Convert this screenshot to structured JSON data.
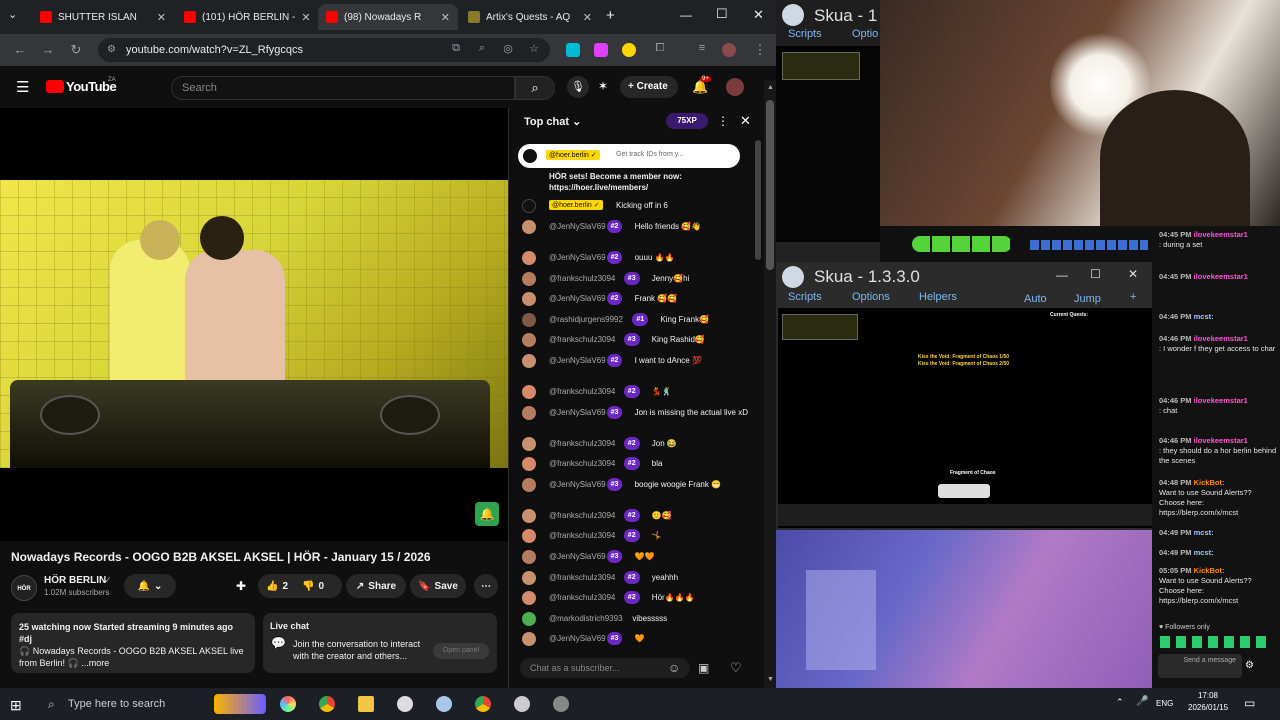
{
  "browser": {
    "tabs": [
      {
        "label": "SHUTTER ISLAN",
        "color": "#ff0000"
      },
      {
        "label": "(101) HÖR BERLIN -",
        "color": "#ff0000"
      },
      {
        "label": "(98) Nowadays R",
        "color": "#ff0000"
      },
      {
        "label": "Artix's Quests - AQ",
        "color": "#8b7a2a"
      }
    ],
    "url": "youtube.com/watch?v=ZL_Rfygcqcs"
  },
  "youtube": {
    "logo": "YouTube",
    "logo_region": "ZA",
    "search_placeholder": "Search",
    "create_label": "Create",
    "notif_count": "9+",
    "video_title": "Nowadays Records - OOGO B2B AKSEL AKSEL | HÖR - January 15 / 2026",
    "channel_name": "HÖR BERLIN",
    "subscribers": "1.02M subscribers",
    "like_count": "2",
    "dislike_count": "0",
    "share_label": "Share",
    "save_label": "Save",
    "desc_line1": "25 watching now  Started streaming 9 minutes ago  #dj",
    "desc_line2": "🎧 Nowadays Records - OOGO B2B AKSEL AKSEL live",
    "desc_line3": "from Berlin! 🎧 ...more",
    "livechat_title": "Live chat",
    "livechat_text": "Join the conversation to interact with the creator and others...",
    "open_panel": "Open panel"
  },
  "chat": {
    "header": "Top chat",
    "xp": "75XP",
    "pinned_name": "@hoer.berlin ✓",
    "pinned_text": "Get track IDs from y...",
    "pinned_msg": "HÖR sets! Become a member now: https://hoer.live/members/",
    "msg0_name": "@hoer.berlin ✓",
    "msg0_text": "Kicking off in 6",
    "messages": [
      {
        "name": "@JenNySlaV69",
        "badge": "#2",
        "text": "Hello friends 🥰👋"
      },
      {
        "name": "@JenNySlaV69",
        "badge": "#2",
        "text": "ouuu 🔥🔥"
      },
      {
        "name": "@frankschulz3094",
        "badge": "#3",
        "text": "Jenny🥰hi"
      },
      {
        "name": "@JenNySlaV69",
        "badge": "#2",
        "text": "Frank 🥰🥰"
      },
      {
        "name": "@rashidjurgens9992",
        "badge": "#1",
        "text": "King Frank🥰"
      },
      {
        "name": "@frankschulz3094",
        "badge": "#3",
        "text": "King Rashid🥰"
      },
      {
        "name": "@JenNySlaV69",
        "badge": "#2",
        "text": "I want to dAnce 💯"
      },
      {
        "name": "@frankschulz3094",
        "badge": "#2",
        "text": "💃🕺"
      },
      {
        "name": "@JenNySlaV69",
        "badge": "#3",
        "text": "Jon is missing the actual live xD"
      },
      {
        "name": "@frankschulz3094",
        "badge": "#2",
        "text": "Jon 😂"
      },
      {
        "name": "@frankschulz3094",
        "badge": "#2",
        "text": "bla"
      },
      {
        "name": "@JenNySlaV69",
        "badge": "#3",
        "text": "boogie woogie Frank 😁"
      },
      {
        "name": "@frankschulz3094",
        "badge": "#2",
        "text": "🙂🥰"
      },
      {
        "name": "@frankschulz3094",
        "badge": "#2",
        "text": "🤸"
      },
      {
        "name": "@JenNySlaV69",
        "badge": "#3",
        "text": "🧡🧡"
      },
      {
        "name": "@frankschulz3094",
        "badge": "#2",
        "text": "yeahhh"
      },
      {
        "name": "@frankschulz3094",
        "badge": "#2",
        "text": "Hör🔥🔥🔥"
      },
      {
        "name": "@markodistrich9393",
        "badge": "",
        "text": "vibesssss"
      },
      {
        "name": "@JenNySlaV69",
        "badge": "#3",
        "text": "🧡"
      }
    ],
    "input_placeholder": "Chat as a subscriber..."
  },
  "skua1": {
    "title": "Skua - 1",
    "tabs": [
      "Scripts",
      "Optio"
    ]
  },
  "skua2": {
    "title": "Skua - 1.3.3.0",
    "tabs": [
      "Scripts",
      "Options",
      "Helpers"
    ],
    "right": [
      "Auto",
      "Jump",
      "+"
    ],
    "quests_title": "Current Quests:",
    "quest_lines": [
      "Kiss the Void: Fragment of Chaos 1/50",
      "Kiss the Void: Fragment of Chaos 2/50"
    ],
    "loot": "Fragment of Chaos"
  },
  "twitch": {
    "messages": [
      {
        "time": "04:45 PM",
        "user": "ilovekeemstar1",
        "text": ": during a set"
      },
      {
        "time": "04:45 PM",
        "user": "ilovekeemstar1",
        "text": ""
      },
      {
        "time": "04:46 PM",
        "user": "mcst:",
        "text": ""
      },
      {
        "time": "04:46 PM",
        "user": "ilovekeemstar1",
        "text": ": I wonder f they get access to char"
      },
      {
        "time": "04:46 PM",
        "user": "ilovekeemstar1",
        "text": ": chat"
      },
      {
        "time": "04:46 PM",
        "user": "ilovekeemstar1",
        "text": ": they should do a hor berlin behind the scenes"
      },
      {
        "time": "04:48 PM",
        "user": "KickBot:",
        "text": "Want to use Sound Alerts?? Choose here: https://blerp.com/x/mcst"
      },
      {
        "time": "04:49 PM",
        "user": "mcst:",
        "text": ""
      },
      {
        "time": "04:49 PM",
        "user": "mcst:",
        "text": ""
      },
      {
        "time": "05:05 PM",
        "user": "KickBot:",
        "text": "Want to use Sound Alerts?? Choose here: https://blerp.com/x/mcst"
      }
    ],
    "followers_only": "Followers only",
    "send": "Send a message"
  },
  "taskbar": {
    "search": "Type here to search",
    "lang": "ENG",
    "time": "17:08",
    "date": "2026/01/15"
  }
}
